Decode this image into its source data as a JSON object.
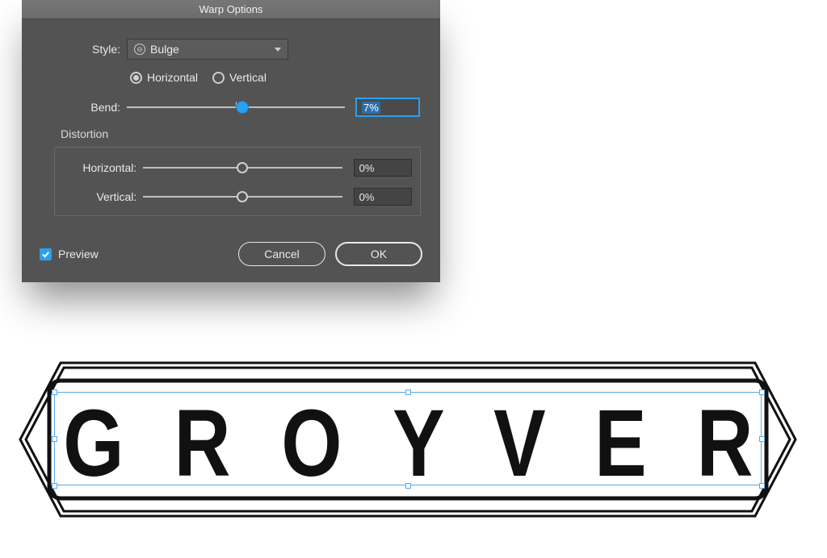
{
  "dialog": {
    "title": "Warp Options",
    "style_label": "Style:",
    "style_value": "Bulge",
    "orientation": {
      "horizontal": "Horizontal",
      "vertical": "Vertical",
      "selected": "horizontal"
    },
    "bend": {
      "label": "Bend:",
      "value": "7%",
      "position_pct": 53
    },
    "distortion": {
      "header": "Distortion",
      "horizontal": {
        "label": "Horizontal:",
        "value": "0%",
        "position_pct": 50
      },
      "vertical": {
        "label": "Vertical:",
        "value": "0%",
        "position_pct": 50
      }
    },
    "preview": {
      "label": "Preview",
      "checked": true
    },
    "buttons": {
      "cancel": "Cancel",
      "ok": "OK"
    }
  },
  "artwork": {
    "text": "GROYVER",
    "letters": [
      "G",
      "R",
      "O",
      "Y",
      "V",
      "E",
      "R"
    ],
    "colors": {
      "stroke": "#111",
      "selection": "#59a8e8"
    }
  }
}
